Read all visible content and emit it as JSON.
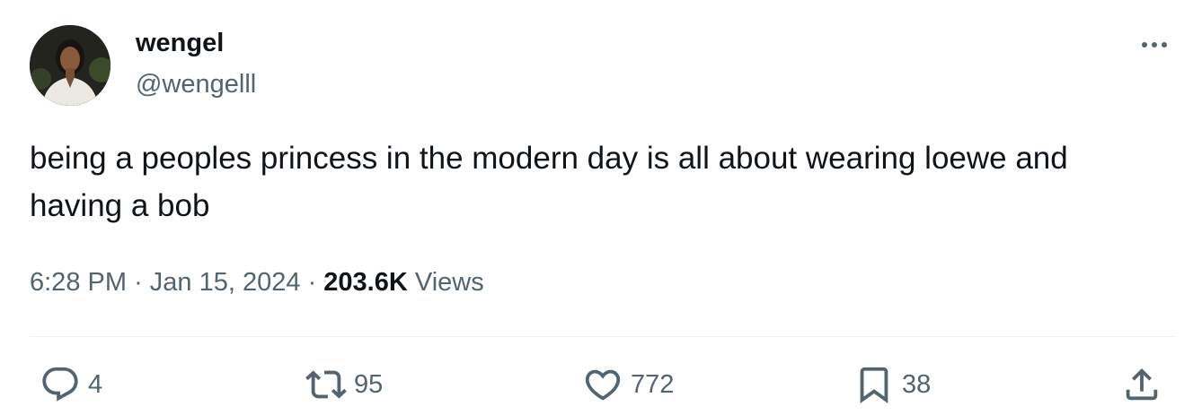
{
  "author": {
    "display_name": "wengel",
    "handle": "@wengelll"
  },
  "tweet": {
    "text": "being a peoples princess in the modern day is all about wearing loewe and having a bob"
  },
  "meta": {
    "time": "6:28 PM",
    "separator": "·",
    "date": "Jan 15, 2024",
    "views_count": "203.6K",
    "views_label": "Views"
  },
  "actions": {
    "replies": "4",
    "reposts": "95",
    "likes": "772",
    "bookmarks": "38"
  },
  "icons": {
    "reply": "reply-icon",
    "repost": "repost-icon",
    "like": "heart-icon",
    "bookmark": "bookmark-icon",
    "share": "share-icon",
    "more": "more-icon"
  },
  "colors": {
    "text_primary": "#0f1419",
    "text_secondary": "#536471",
    "divider": "#eff3f4"
  }
}
